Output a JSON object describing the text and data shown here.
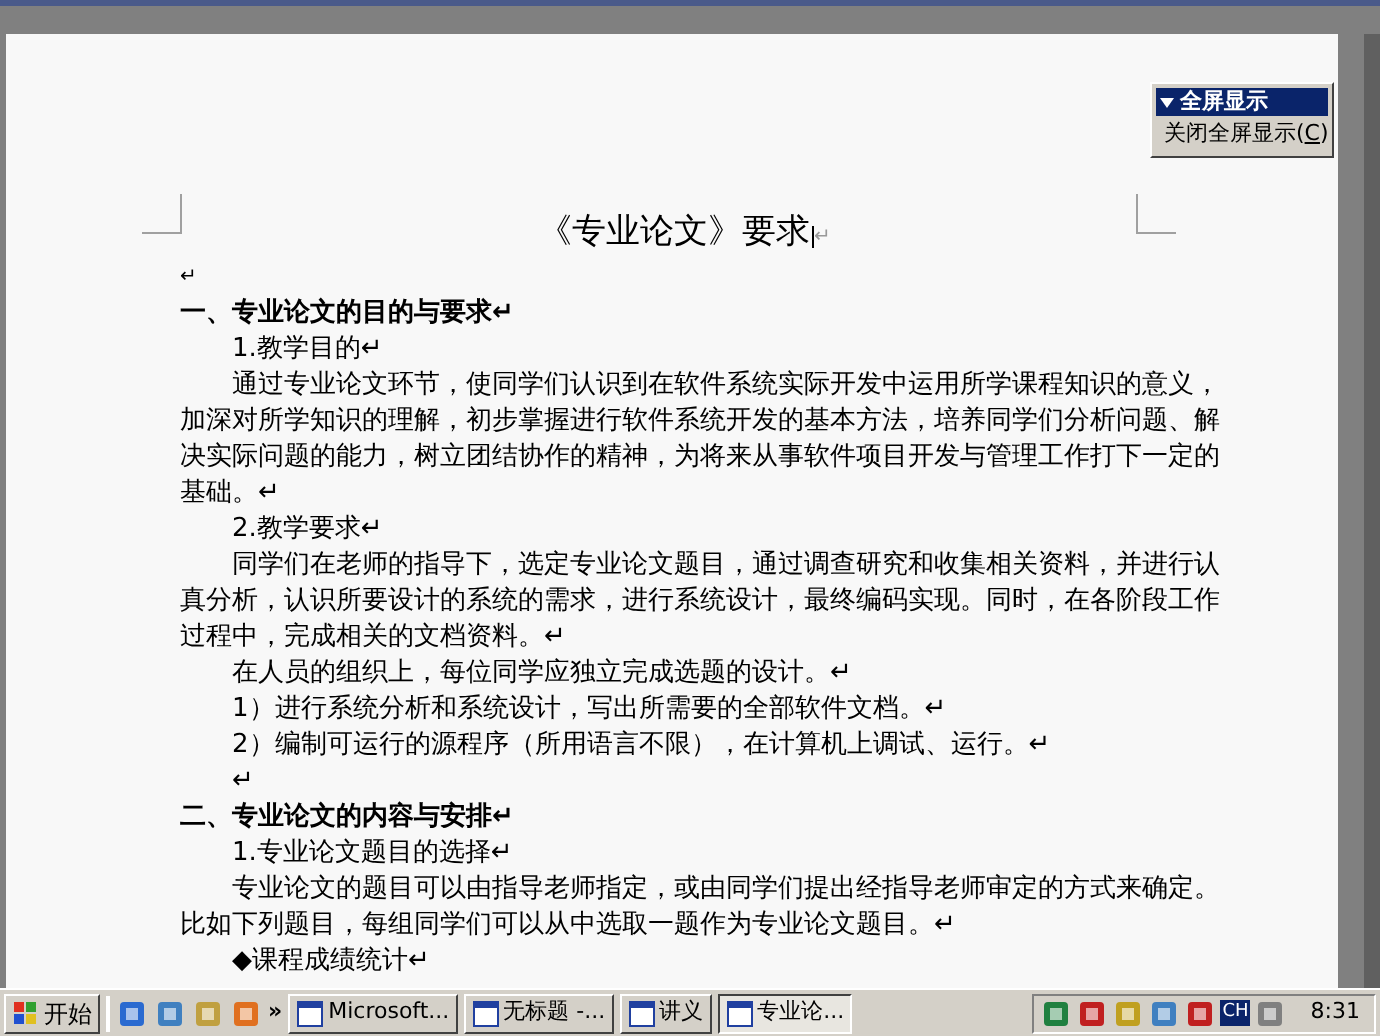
{
  "fullscreen_toolbar": {
    "title": "全屏显示",
    "button": {
      "before": "关闭全屏显示(",
      "accel": "C",
      "after": ")"
    }
  },
  "document": {
    "title": "《专业论文》要求",
    "title_mark": "↵",
    "blocks": [
      {
        "kind": "empty",
        "lines": [
          "↵"
        ]
      },
      {
        "kind": "heading",
        "lines": [
          "一、专业论文的目的与要求↵"
        ]
      },
      {
        "kind": "sub",
        "lines": [
          "1.教学目的↵"
        ]
      },
      {
        "kind": "para",
        "lines": [
          "通过专业论文环节，使同学们认识到在软件系统实际开发中运用所学课程知识的意义，",
          "加深对所学知识的理解，初步掌握进行软件系统开发的基本方法，培养同学们分析问题、解",
          "决实际问题的能力，树立团结协作的精神，为将来从事软件项目开发与管理工作打下一定的",
          "基础。↵"
        ]
      },
      {
        "kind": "sub",
        "lines": [
          "2.教学要求↵"
        ]
      },
      {
        "kind": "para",
        "lines": [
          "同学们在老师的指导下，选定专业论文题目，通过调查研究和收集相关资料，并进行认",
          "真分析，认识所要设计的系统的需求，进行系统设计，最终编码实现。同时，在各阶段工作",
          "过程中，完成相关的文档资料。↵"
        ]
      },
      {
        "kind": "sub",
        "lines": [
          "在人员的组织上，每位同学应独立完成选题的设计。↵"
        ]
      },
      {
        "kind": "sub",
        "lines": [
          "1）进行系统分析和系统设计，写出所需要的全部软件文档。↵"
        ]
      },
      {
        "kind": "sub",
        "lines": [
          "2）编制可运行的源程序（所用语言不限），在计算机上调试、运行。↵"
        ]
      },
      {
        "kind": "sub",
        "lines": [
          "↵"
        ]
      },
      {
        "kind": "heading",
        "lines": [
          "二、专业论文的内容与安排↵"
        ]
      },
      {
        "kind": "sub",
        "lines": [
          "1.专业论文题目的选择↵"
        ]
      },
      {
        "kind": "para",
        "lines": [
          "专业论文的题目可以由指导老师指定，或由同学们提出经指导老师审定的方式来确定。",
          "比如下列题目，每组同学们可以从中选取一题作为专业论文题目。↵"
        ]
      },
      {
        "kind": "sub",
        "lines": [
          "◆课程成绩统计↵"
        ]
      }
    ]
  },
  "taskbar": {
    "start": "开始",
    "more": "»",
    "tasks": [
      {
        "label": "Microsoft...",
        "selected": false
      },
      {
        "label": "无标题 -...",
        "selected": false
      },
      {
        "label": "讲义",
        "selected": false
      },
      {
        "label": "专业论...",
        "selected": true
      }
    ],
    "language": "CH",
    "clock": "8:31"
  }
}
